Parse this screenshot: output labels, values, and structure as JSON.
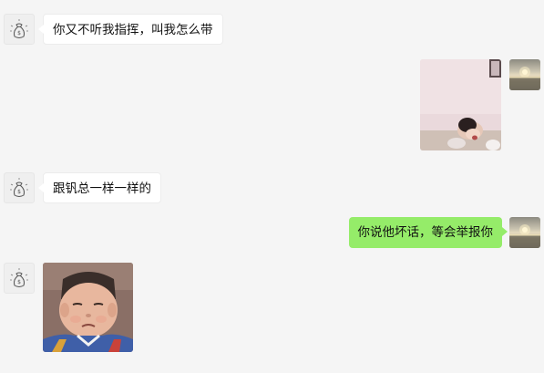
{
  "chat": {
    "background_color": "#f5f5f5",
    "self_bubble_color": "#95ec69",
    "other_bubble_color": "#ffffff",
    "messages": [
      {
        "sender": "other",
        "type": "text",
        "text": "你又不听我指挥，叫我怎么带"
      },
      {
        "sender": "self",
        "type": "image",
        "image": "crying-child-photo"
      },
      {
        "sender": "other",
        "type": "text",
        "text": "跟钒总一样一样的"
      },
      {
        "sender": "self",
        "type": "text",
        "text": "你说他坏话，等会举报你"
      },
      {
        "sender": "other",
        "type": "image",
        "image": "pouting-boy-sticker"
      }
    ]
  }
}
